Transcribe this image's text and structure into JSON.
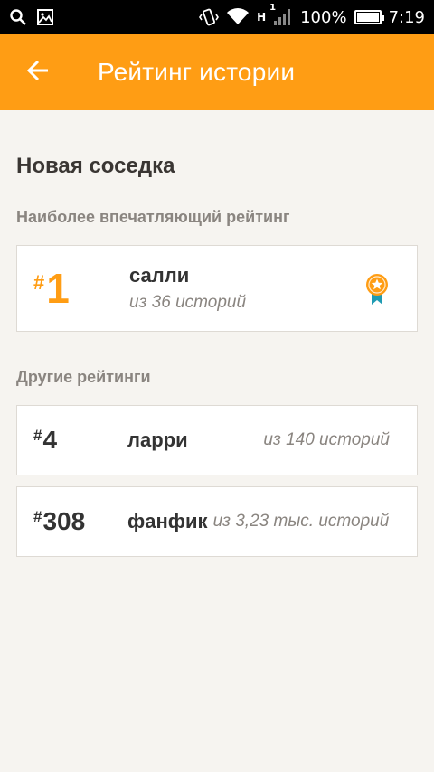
{
  "status_bar": {
    "battery_level": "100%",
    "battery_fraction": 1.0,
    "time": "7:19",
    "network_label": "H",
    "network_sup": "1",
    "icons": [
      "search-icon",
      "image-icon",
      "vibrate-icon",
      "wifi-icon",
      "signal-icon",
      "battery-icon"
    ]
  },
  "app_bar": {
    "title": "Рейтинг истории",
    "back_icon": "arrow-left-icon",
    "color": "#ff9d14"
  },
  "story": {
    "title": "Новая соседка"
  },
  "top_rating": {
    "section_label": "Наиболее впечатляющий рейтинг",
    "hash": "#",
    "rank": "1",
    "tag": "салли",
    "count": "из 36 историй",
    "badge_icon": "medal-icon"
  },
  "other_ratings": {
    "section_label": "Другие рейтинги",
    "items": [
      {
        "hash": "#",
        "rank": "4",
        "tag": "ларри",
        "count": "из 140 историй"
      },
      {
        "hash": "#",
        "rank": "308",
        "tag": "фанфик",
        "count": "из 3,23 тыс. историй"
      }
    ]
  },
  "colors": {
    "accent": "#ff9d14",
    "background": "#f6f4f0",
    "secondary_text": "#8a8580",
    "badge_ribbon": "#1f9bb3"
  }
}
